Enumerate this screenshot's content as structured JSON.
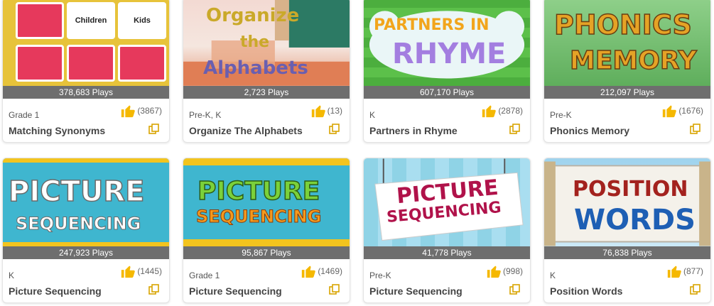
{
  "cards": [
    {
      "plays": "378,683 Plays",
      "grade": "Grade 1",
      "title": "Matching Synonyms",
      "likes": "(3867)",
      "words": [
        "Children",
        "Kids"
      ]
    },
    {
      "plays": "2,723 Plays",
      "grade": "Pre-K, K",
      "title": "Organize The Alphabets",
      "likes": "(13)",
      "art": [
        "Organize",
        "the",
        "Alphabets"
      ]
    },
    {
      "plays": "607,170 Plays",
      "grade": "K",
      "title": "Partners in Rhyme",
      "likes": "(2878)",
      "art": [
        "PARTNERS IN",
        "RHYME"
      ]
    },
    {
      "plays": "212,097 Plays",
      "grade": "Pre-K",
      "title": "Phonics Memory",
      "likes": "(1676)",
      "art": [
        "PHONICS",
        "MEMORY"
      ]
    },
    {
      "plays": "247,923 Plays",
      "grade": "K",
      "title": "Picture Sequencing",
      "likes": "(1445)",
      "art": [
        "PICTURE",
        "SEQUENCING"
      ]
    },
    {
      "plays": "95,867 Plays",
      "grade": "Grade 1",
      "title": "Picture Sequencing",
      "likes": "(1469)",
      "art": [
        "PICTURE",
        "SEQUENCING"
      ]
    },
    {
      "plays": "41,778 Plays",
      "grade": "Pre-K",
      "title": "Picture Sequencing",
      "likes": "(998)",
      "art": [
        "PICTURE",
        "SEQUENCING"
      ]
    },
    {
      "plays": "76,838 Plays",
      "grade": "K",
      "title": "Position Words",
      "likes": "(877)",
      "art": [
        "POSITION",
        "WORDS"
      ]
    }
  ],
  "colors": {
    "like": "#f5b800",
    "copy": "#d9a400",
    "plays_bar": "#6e6e6e"
  }
}
